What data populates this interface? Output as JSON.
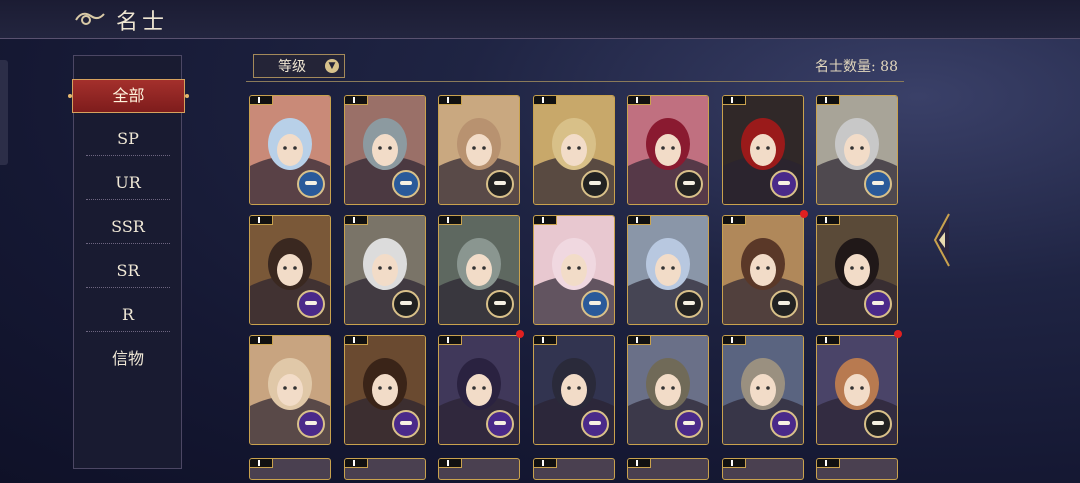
{
  "header": {
    "title": "名士"
  },
  "sidebar": {
    "items": [
      "全部",
      "SP",
      "UR",
      "SSR",
      "SR",
      "R",
      "信物"
    ],
    "active": "全部"
  },
  "toolbar": {
    "sort_label": "等级",
    "count_label": "名士数量: 88"
  },
  "colors": {
    "accent_red": "#a4302c",
    "gold_border": "#c9a24e",
    "background": "#191b31"
  },
  "cards": [
    {
      "hair": "#b8d0e8",
      "bg": "#c98a78",
      "emblem": "blue"
    },
    {
      "hair": "#8c9aa0",
      "bg": "#9a7068",
      "emblem": "blue"
    },
    {
      "hair": "#b89270",
      "bg": "#c9a880",
      "emblem": "dark"
    },
    {
      "hair": "#d8c088",
      "bg": "#c8a86a",
      "emblem": "dark"
    },
    {
      "hair": "#8a1a30",
      "bg": "#c07080",
      "emblem": "dark"
    },
    {
      "hair": "#9a1a1a",
      "bg": "#302828",
      "emblem": "purple"
    },
    {
      "hair": "#c8c8c8",
      "bg": "#a8a498",
      "emblem": "blue"
    },
    {
      "hair": "#3a2820",
      "bg": "#7a5838",
      "emblem": "purple"
    },
    {
      "hair": "#dcdcdc",
      "bg": "#7a7468",
      "emblem": "dark"
    },
    {
      "hair": "#8a9690",
      "bg": "#5e6860",
      "emblem": "dark"
    },
    {
      "hair": "#f0d8e0",
      "bg": "#e8c8d0",
      "emblem": "blue"
    },
    {
      "hair": "#b8c8e0",
      "bg": "#8a96a8",
      "emblem": "dark"
    },
    {
      "hair": "#5a3828",
      "bg": "#b0885a",
      "emblem": "dark",
      "reddot": true
    },
    {
      "hair": "#201818",
      "bg": "#5a4a38",
      "emblem": "purple"
    },
    {
      "hair": "#e0c8a8",
      "bg": "#c8a480",
      "emblem": "purple"
    },
    {
      "hair": "#3a2418",
      "bg": "#6a4a30",
      "emblem": "purple"
    },
    {
      "hair": "#2a2240",
      "bg": "#40385a",
      "emblem": "purple",
      "reddot": true
    },
    {
      "hair": "#2a2a3a",
      "bg": "#323450",
      "emblem": "purple"
    },
    {
      "hair": "#706a58",
      "bg": "#6a7088",
      "emblem": "purple"
    },
    {
      "hair": "#9a9080",
      "bg": "#5a6480",
      "emblem": "purple"
    },
    {
      "hair": "#b87a50",
      "bg": "#4a4468",
      "emblem": "dark",
      "reddot": true
    }
  ]
}
